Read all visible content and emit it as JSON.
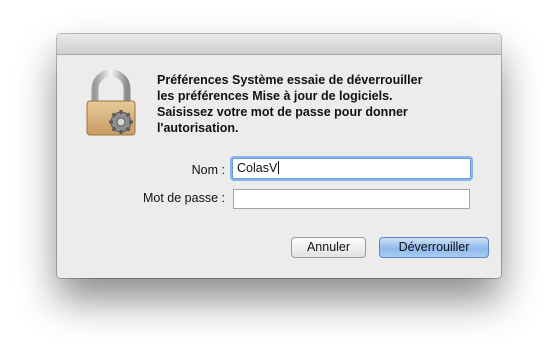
{
  "dialog": {
    "message_lines": [
      "Préférences Système essaie de déverrouiller",
      "les préférences Mise à jour de logiciels.",
      "Saisissez votre mot de passe pour donner",
      "l'autorisation."
    ],
    "icon": "padlock-with-gear-icon"
  },
  "form": {
    "name_label": "Nom :",
    "name_value": "ColasV",
    "password_label": "Mot de passe :",
    "password_value": ""
  },
  "buttons": {
    "cancel_label": "Annuler",
    "unlock_label": "Déverrouiller"
  },
  "colors": {
    "default_button": "#8fb9ec",
    "focus_ring": "#8ab4ec"
  }
}
